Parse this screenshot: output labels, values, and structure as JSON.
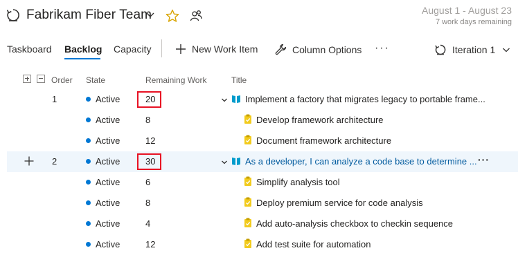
{
  "header": {
    "team_name": "Fabrikam Fiber Team",
    "date_range": "August 1 - August 23",
    "days_remaining": "7 work days remaining"
  },
  "toolbar": {
    "tabs": [
      {
        "label": "Taskboard",
        "active": false
      },
      {
        "label": "Backlog",
        "active": true
      },
      {
        "label": "Capacity",
        "active": false
      }
    ],
    "new_work_item": "New Work Item",
    "column_options": "Column Options",
    "more": "···",
    "iteration": "Iteration 1"
  },
  "grid": {
    "columns": [
      "Order",
      "State",
      "Remaining Work",
      "Title"
    ],
    "rows": [
      {
        "order": "1",
        "state": "Active",
        "remaining": "20",
        "title": "Implement a factory that migrates legacy to portable frame...",
        "type": "backlog-item",
        "highlighted": true
      },
      {
        "order": "",
        "state": "Active",
        "remaining": "8",
        "title": "Develop framework architecture",
        "type": "task"
      },
      {
        "order": "",
        "state": "Active",
        "remaining": "12",
        "title": "Document framework architecture",
        "type": "task"
      },
      {
        "order": "2",
        "state": "Active",
        "remaining": "30",
        "title": "As a developer, I can analyze a code base to determine ...",
        "type": "backlog-item",
        "highlighted": true,
        "selected": true
      },
      {
        "order": "",
        "state": "Active",
        "remaining": "6",
        "title": "Simplify analysis tool",
        "type": "task"
      },
      {
        "order": "",
        "state": "Active",
        "remaining": "8",
        "title": "Deploy premium service for code analysis",
        "type": "task"
      },
      {
        "order": "",
        "state": "Active",
        "remaining": "4",
        "title": "Add auto-analysis checkbox to checkin sequence",
        "type": "task"
      },
      {
        "order": "",
        "state": "Active",
        "remaining": "12",
        "title": "Add test suite for automation",
        "type": "task"
      }
    ]
  },
  "colors": {
    "accent": "#0078d4",
    "highlight_border": "#e81123",
    "selected_row": "#eff6fc",
    "task_icon": "#f2cb1d",
    "backlog_icon": "#009ccc"
  },
  "icons": {
    "team": "sprint-icon",
    "favorite": "star-icon",
    "members": "people-icon",
    "new_item": "plus-icon",
    "column_options": "wrench-icon",
    "iteration": "sprint-icon"
  }
}
